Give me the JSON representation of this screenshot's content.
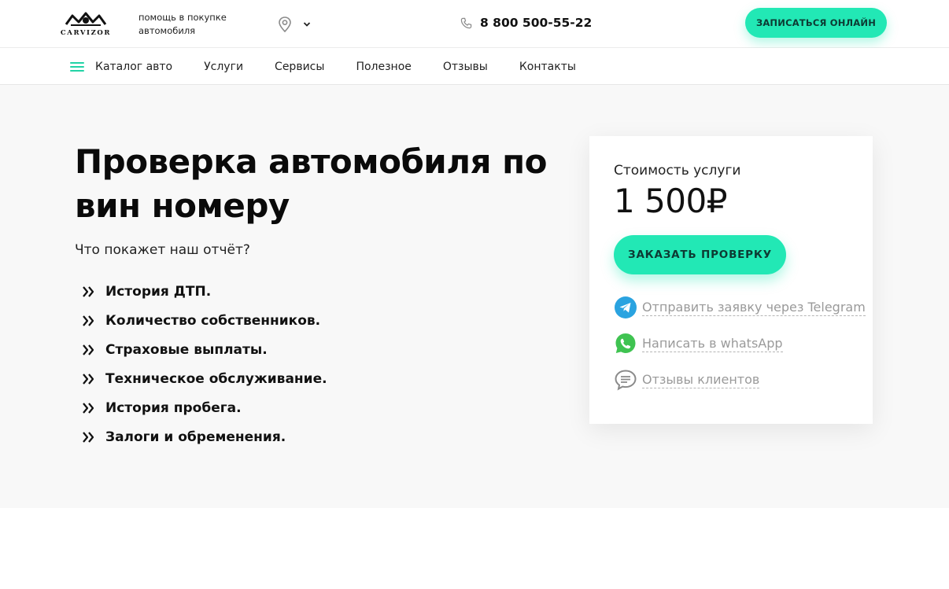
{
  "header": {
    "logo_text": "CARVIZOR",
    "tagline": "помощь в покупке автомобиля",
    "location_icon": "map-pin-icon",
    "dropdown_icon": "chevron-down-icon",
    "phone_icon": "phone-icon",
    "phone": "8 800 500-55-22",
    "cta_label": "ЗАПИСАТЬСЯ ОНЛАЙН"
  },
  "nav": {
    "menu_icon": "hamburger-icon",
    "items": [
      {
        "label": "Каталог авто"
      },
      {
        "label": "Услуги"
      },
      {
        "label": "Сервисы"
      },
      {
        "label": "Полезное"
      },
      {
        "label": "Отзывы"
      },
      {
        "label": "Контакты"
      }
    ]
  },
  "hero": {
    "title": "Проверка автомобиля по вин номеру",
    "subtitle": "Что покажет наш отчёт?",
    "bullet_icon": "double-chevron-right-icon",
    "features": [
      "История ДТП.",
      "Количество собственников.",
      "Страховые выплаты.",
      "Техническое обслуживание.",
      "История пробега.",
      "Залоги и обременения."
    ]
  },
  "price_card": {
    "label": "Стоимость услуги",
    "price": "1 500₽",
    "order_label": "ЗАКАЗАТЬ ПРОВЕРКУ",
    "links": [
      {
        "icon": "telegram-icon",
        "label": "Отправить заявку через Telegram"
      },
      {
        "icon": "whatsapp-icon",
        "label": "Написать в whatsApp"
      },
      {
        "icon": "speech-bubble-icon",
        "label": "Отзывы клиентов"
      }
    ]
  },
  "colors": {
    "accent": "#22e8b5",
    "hero_bg": "#f8f8f8",
    "telegram": "#2aa3e0",
    "whatsapp": "#3fc351",
    "link_gray": "#9a9a9a"
  }
}
